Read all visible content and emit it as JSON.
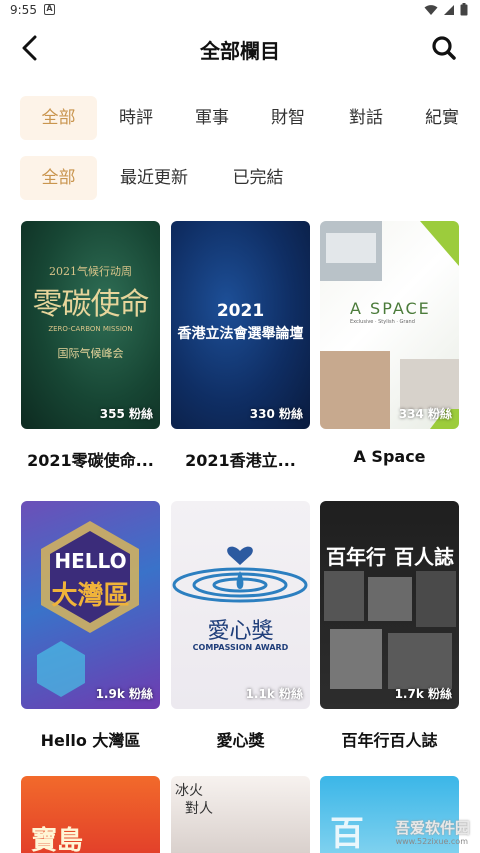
{
  "status_bar": {
    "time": "9:55",
    "notif_letter": "A"
  },
  "header": {
    "title": "全部欄目"
  },
  "categories": [
    "全部",
    "時評",
    "軍事",
    "財智",
    "對話",
    "紀實"
  ],
  "filters": [
    "全部",
    "最近更新",
    "已完結"
  ],
  "programs": [
    {
      "title": "2021零碳使命...",
      "fans": "355 粉絲",
      "poster_lines": [
        "2021气候行动周",
        "零碳使命",
        "ZERO-CARBON MISSION",
        "国际气候峰会"
      ]
    },
    {
      "title": "2021香港立...",
      "fans": "330 粉絲",
      "poster_lines": [
        "2021",
        "香港立法會選舉論壇"
      ]
    },
    {
      "title": "A Space",
      "fans": "334 粉絲",
      "poster_lines": [
        "A SPACE",
        "Exclusive · Stylish · Grand"
      ]
    },
    {
      "title": "Hello 大灣區",
      "fans": "1.9k 粉絲",
      "poster_lines": [
        "HELLO",
        "大灣區"
      ]
    },
    {
      "title": "愛心獎",
      "fans": "1.1k 粉絲",
      "poster_lines": [
        "愛心獎",
        "COMPASSION AWARD"
      ]
    },
    {
      "title": "百年行百人誌",
      "fans": "1.7k 粉絲",
      "poster_lines": [
        "百年行",
        "百人誌"
      ]
    },
    {
      "title": "",
      "fans": "",
      "poster_lines": [
        "寶島"
      ]
    },
    {
      "title": "",
      "fans": "",
      "poster_lines": [
        "冰火",
        "對人"
      ]
    },
    {
      "title": "",
      "fans": "",
      "poster_lines": [
        "百"
      ]
    }
  ],
  "watermark": {
    "text": "吾爱软件园",
    "url": "www.52zixue.com"
  },
  "colors": {
    "accent": "#c9954f",
    "accent_bg": "#fdf3e8"
  }
}
